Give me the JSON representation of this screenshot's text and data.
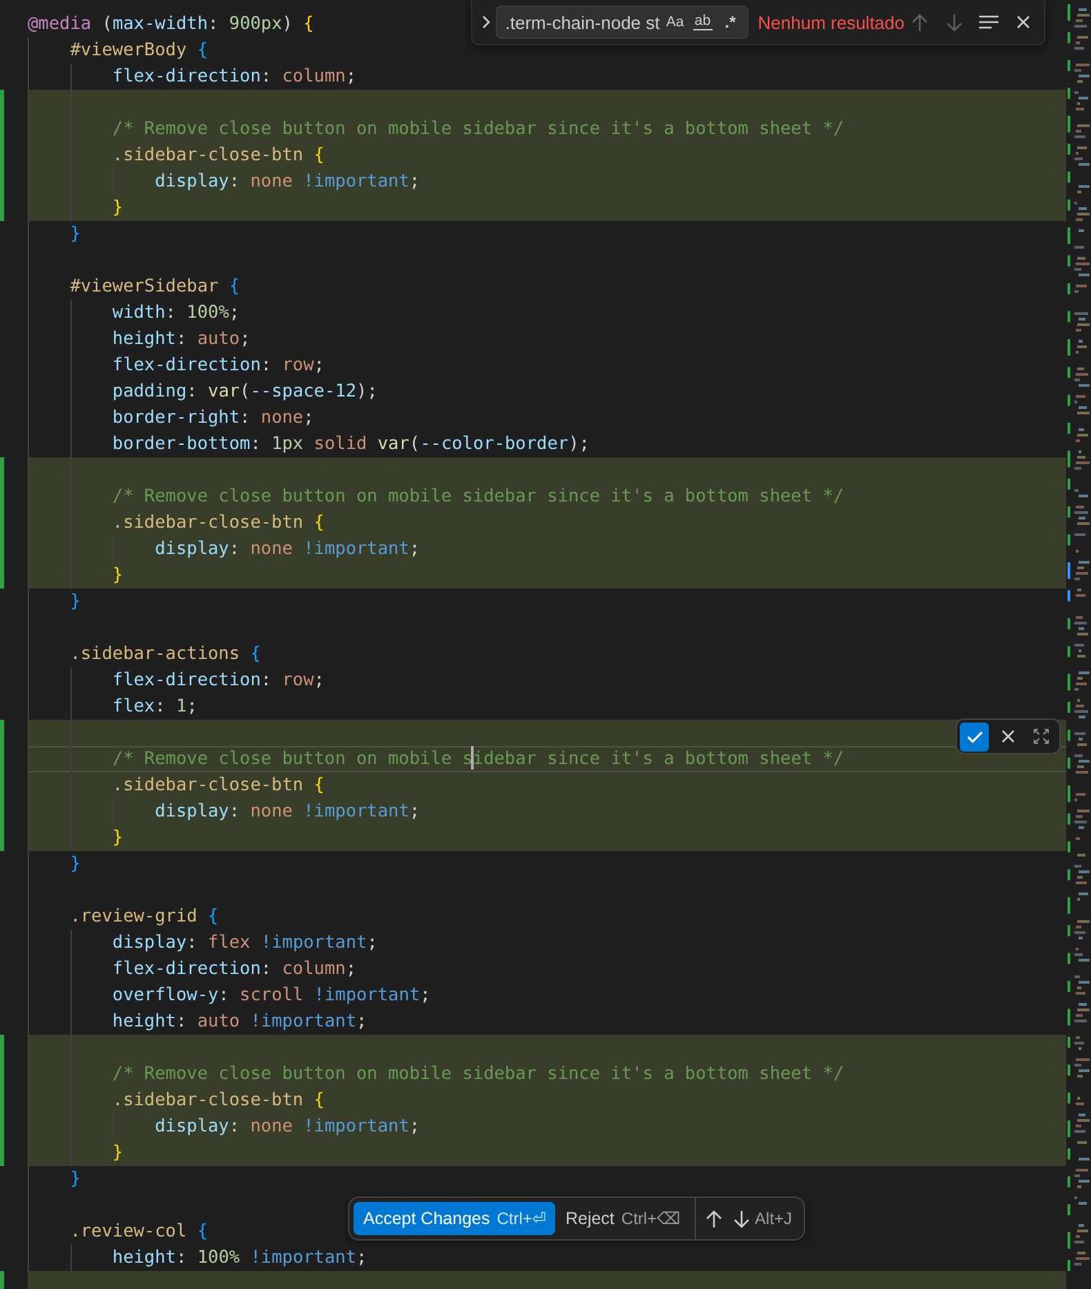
{
  "find_widget": {
    "value": ".term-chain-node st",
    "options": [
      {
        "kind": "case",
        "label": "Aa",
        "on": false
      },
      {
        "kind": "word",
        "label": "ab",
        "on": false
      },
      {
        "kind": "regex",
        "label": ".*",
        "on": false
      }
    ],
    "status": "Nenhum resultado",
    "previous_match": {
      "disabled": true
    },
    "next_match": {
      "disabled": true
    }
  },
  "editor": {
    "lines": [
      {
        "text": "@media (max-width: 900px) {",
        "added": false
      },
      {
        "text": "    #viewerBody {",
        "added": false
      },
      {
        "text": "        flex-direction: column;",
        "added": false
      },
      {
        "added": true
      },
      {
        "text": "        /* Remove close button on mobile sidebar since it's a bottom sheet */",
        "added": true
      },
      {
        "text": "        .sidebar-close-btn {",
        "added": true
      },
      {
        "text": "            display: none !important;",
        "added": true
      },
      {
        "text": "        }",
        "added": true
      },
      {
        "text": "    }",
        "added": false
      },
      {
        "added": false
      },
      {
        "text": "    #viewerSidebar {",
        "added": false
      },
      {
        "text": "        width: 100%;",
        "added": false
      },
      {
        "text": "        height: auto;",
        "added": false
      },
      {
        "text": "        flex-direction: row;",
        "added": false
      },
      {
        "text": "        padding: var(--space-12);",
        "added": false
      },
      {
        "text": "        border-right: none;",
        "added": false
      },
      {
        "text": "        border-bottom: 1px solid var(--color-border);",
        "added": false
      },
      {
        "added": true
      },
      {
        "text": "        /* Remove close button on mobile sidebar since it's a bottom sheet */",
        "added": true
      },
      {
        "text": "        .sidebar-close-btn {",
        "added": true
      },
      {
        "text": "            display: none !important;",
        "added": true
      },
      {
        "text": "        }",
        "added": true
      },
      {
        "text": "    }",
        "added": false
      },
      {
        "added": false
      },
      {
        "text": "    .sidebar-actions {",
        "added": false
      },
      {
        "text": "        flex-direction: row;",
        "added": false
      },
      {
        "text": "        flex: 1;",
        "added": false
      },
      {
        "added": true,
        "hunk_toolbar": true
      },
      {
        "text_before_cursor": "        /* Remove close button on mobile s",
        "text_after_cursor": "idebar since it's a bottom sheet */",
        "added": true
      },
      {
        "text": "        .sidebar-close-btn {",
        "added": true
      },
      {
        "text": "            display: none !important;",
        "added": true
      },
      {
        "text": "        }",
        "added": true
      },
      {
        "text": "    }",
        "added": false
      },
      {
        "added": false
      },
      {
        "text": "    .review-grid {",
        "added": false
      },
      {
        "text": "        display: flex !important;",
        "added": false
      },
      {
        "text": "        flex-direction: column;",
        "added": false
      },
      {
        "text": "        overflow-y: scroll !important;",
        "added": false
      },
      {
        "text": "        height: auto !important;",
        "added": false
      },
      {
        "added": true
      },
      {
        "text": "        /* Remove close button on mobile sidebar since it's a bottom sheet */",
        "added": true
      },
      {
        "text": "        .sidebar-close-btn {",
        "added": true
      },
      {
        "text": "            display: none !important;",
        "added": true
      },
      {
        "text": "        }",
        "added": true
      },
      {
        "text": "    }",
        "added": false
      },
      {
        "added": false
      },
      {
        "text": "    .review-col {",
        "added": false
      },
      {
        "text": "        height: 100% !important;",
        "added": false
      },
      {
        "added": true
      }
    ]
  },
  "change_bar": {
    "accept": {
      "label": "Accept Changes",
      "keybinding": "Ctrl+⏎"
    },
    "reject": {
      "label": "Reject",
      "keybinding": "Ctrl+⌫"
    },
    "next_keybinding": "Alt+J"
  }
}
